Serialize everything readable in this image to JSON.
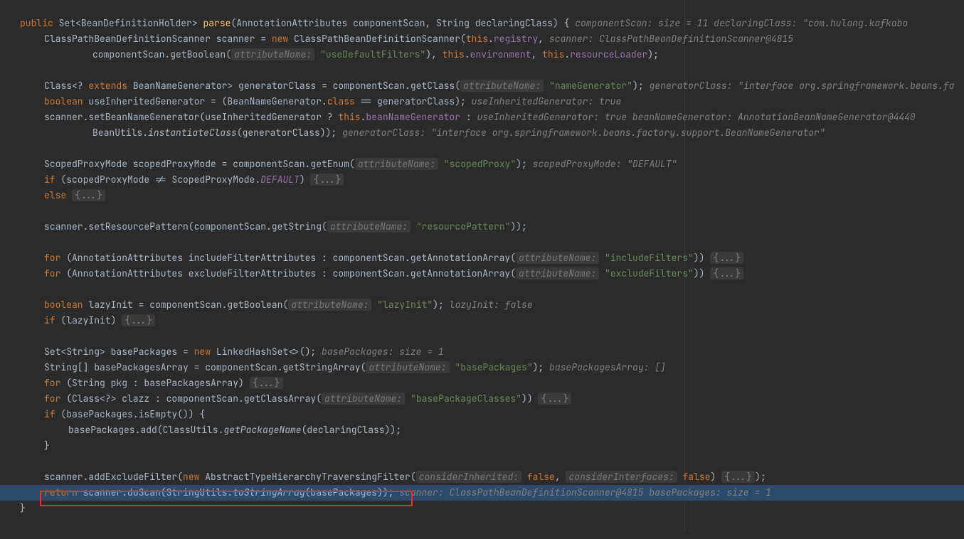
{
  "kw": {
    "public": "public",
    "new": "new",
    "this": "this",
    "extends": "extends",
    "boolean": "boolean",
    "class": "class",
    "if": "if",
    "else": "else",
    "for": "for",
    "return": "return",
    "false": "false"
  },
  "sig": {
    "ret": "Set<BeanDefinitionHolder>",
    "name": "parse",
    "p1t": "AnnotationAttributes",
    "p1n": "componentScan",
    "p2t": "String",
    "p2n": "declaringClass",
    "hint1": "componentScan:  size = 11",
    "hint2": "declaringClass: \"com.hulang.kafkabo"
  },
  "l2": {
    "t1": "ClassPathBeanDefinitionScanner scanner = ",
    "t2": "ClassPathBeanDefinitionScanner(",
    "t3": ".",
    "registry": "registry",
    "hint": "scanner: ClassPathBeanDefinitionScanner@4815"
  },
  "l3": {
    "t1": "componentScan.getBoolean(",
    "label": "attributeName:",
    "str": "\"useDefaultFilters\"",
    "t2": "), ",
    "t3": ".",
    "env": "environment",
    "rl": "resourceLoader"
  },
  "l5": {
    "t1": "Class<? ",
    "t2": "BeanNameGenerator> generatorClass = componentScan.getClass(",
    "label": "attributeName:",
    "str": "\"nameGenerator\"",
    "hint": "generatorClass: \"interface org.springframework.beans.fa"
  },
  "l6": {
    "t1": " useInheritedGenerator = (BeanNameGenerator.",
    "t2": " == generatorClass);",
    "hint": "useInheritedGenerator: true"
  },
  "l7": {
    "t1": "scanner.setBeanNameGenerator(useInheritedGenerator ? ",
    "t2": ".",
    "bng": "beanNameGenerator",
    "hint1": "useInheritedGenerator: true",
    "hint2": "beanNameGenerator: AnnotationBeanNameGenerator@4440"
  },
  "l8": {
    "t1": "BeanUtils.",
    "call": "instantiateClass",
    "t2": "(generatorClass));",
    "hint": "generatorClass: \"interface org.springframework.beans.factory.support.BeanNameGenerator\""
  },
  "l10": {
    "t1": "ScopedProxyMode scopedProxyMode = componentScan.getEnum(",
    "label": "attributeName:",
    "str": "\"scopedProxy\"",
    "hint": "scopedProxyMode: \"DEFAULT\""
  },
  "l11": {
    "t1": " (scopedProxyMode != ScopedProxyMode.",
    "def": "DEFAULT",
    "fold": "{...}"
  },
  "l12": {
    "fold": "{...}"
  },
  "l14": {
    "t1": "scanner.setResourcePattern(componentScan.getString(",
    "label": "attributeName:",
    "str": "\"resourcePattern\""
  },
  "l16": {
    "t1": " (AnnotationAttributes includeFilterAttributes : componentScan.getAnnotationArray(",
    "label": "attributeName:",
    "str": "\"includeFilters\"",
    "fold": "{...}"
  },
  "l17": {
    "t1": " (AnnotationAttributes excludeFilterAttributes : componentScan.getAnnotationArray(",
    "label": "attributeName:",
    "str": "\"excludeFilters\"",
    "fold": "{...}"
  },
  "l19": {
    "t1": " lazyInit = componentScan.getBoolean(",
    "label": "attributeName:",
    "str": "\"lazyInit\"",
    "hint": "lazyInit: false"
  },
  "l20": {
    "t1": " (lazyInit) ",
    "fold": "{...}"
  },
  "l22": {
    "t1": "Set<String> basePackages = ",
    "t2": "LinkedHashSet<>();",
    "hint": "basePackages:  size = 1"
  },
  "l23": {
    "t1": "String[] basePackagesArray = componentScan.getStringArray(",
    "label": "attributeName:",
    "str": "\"basePackages\"",
    "hint": "basePackagesArray: []"
  },
  "l24": {
    "t1": " (String pkg : basePackagesArray) ",
    "fold": "{...}"
  },
  "l25": {
    "t1": " (Class<?> clazz : componentScan.getClassArray(",
    "label": "attributeName:",
    "str": "\"basePackageClasses\"",
    "fold": "{...}"
  },
  "l26": {
    "t1": " (basePackages.isEmpty()) {"
  },
  "l27": {
    "t1": "basePackages.add(ClassUtils.",
    "call": "getPackageName",
    "t2": "(declaringClass));"
  },
  "l30": {
    "t1": "scanner.addExcludeFilter(",
    "t2": "AbstractTypeHierarchyTraversingFilter(",
    "label1": "considerInherited:",
    "label2": "considerInterfaces:",
    "fold": "{...}"
  },
  "l31": {
    "t1": " scanner.doScan(StringUtils.",
    "call": "toStringArray",
    "t2": "(basePackages));",
    "hint1": "scanner: ClassPathBeanDefinitionScanner@4815",
    "hint2": "basePackages:  size = 1"
  }
}
